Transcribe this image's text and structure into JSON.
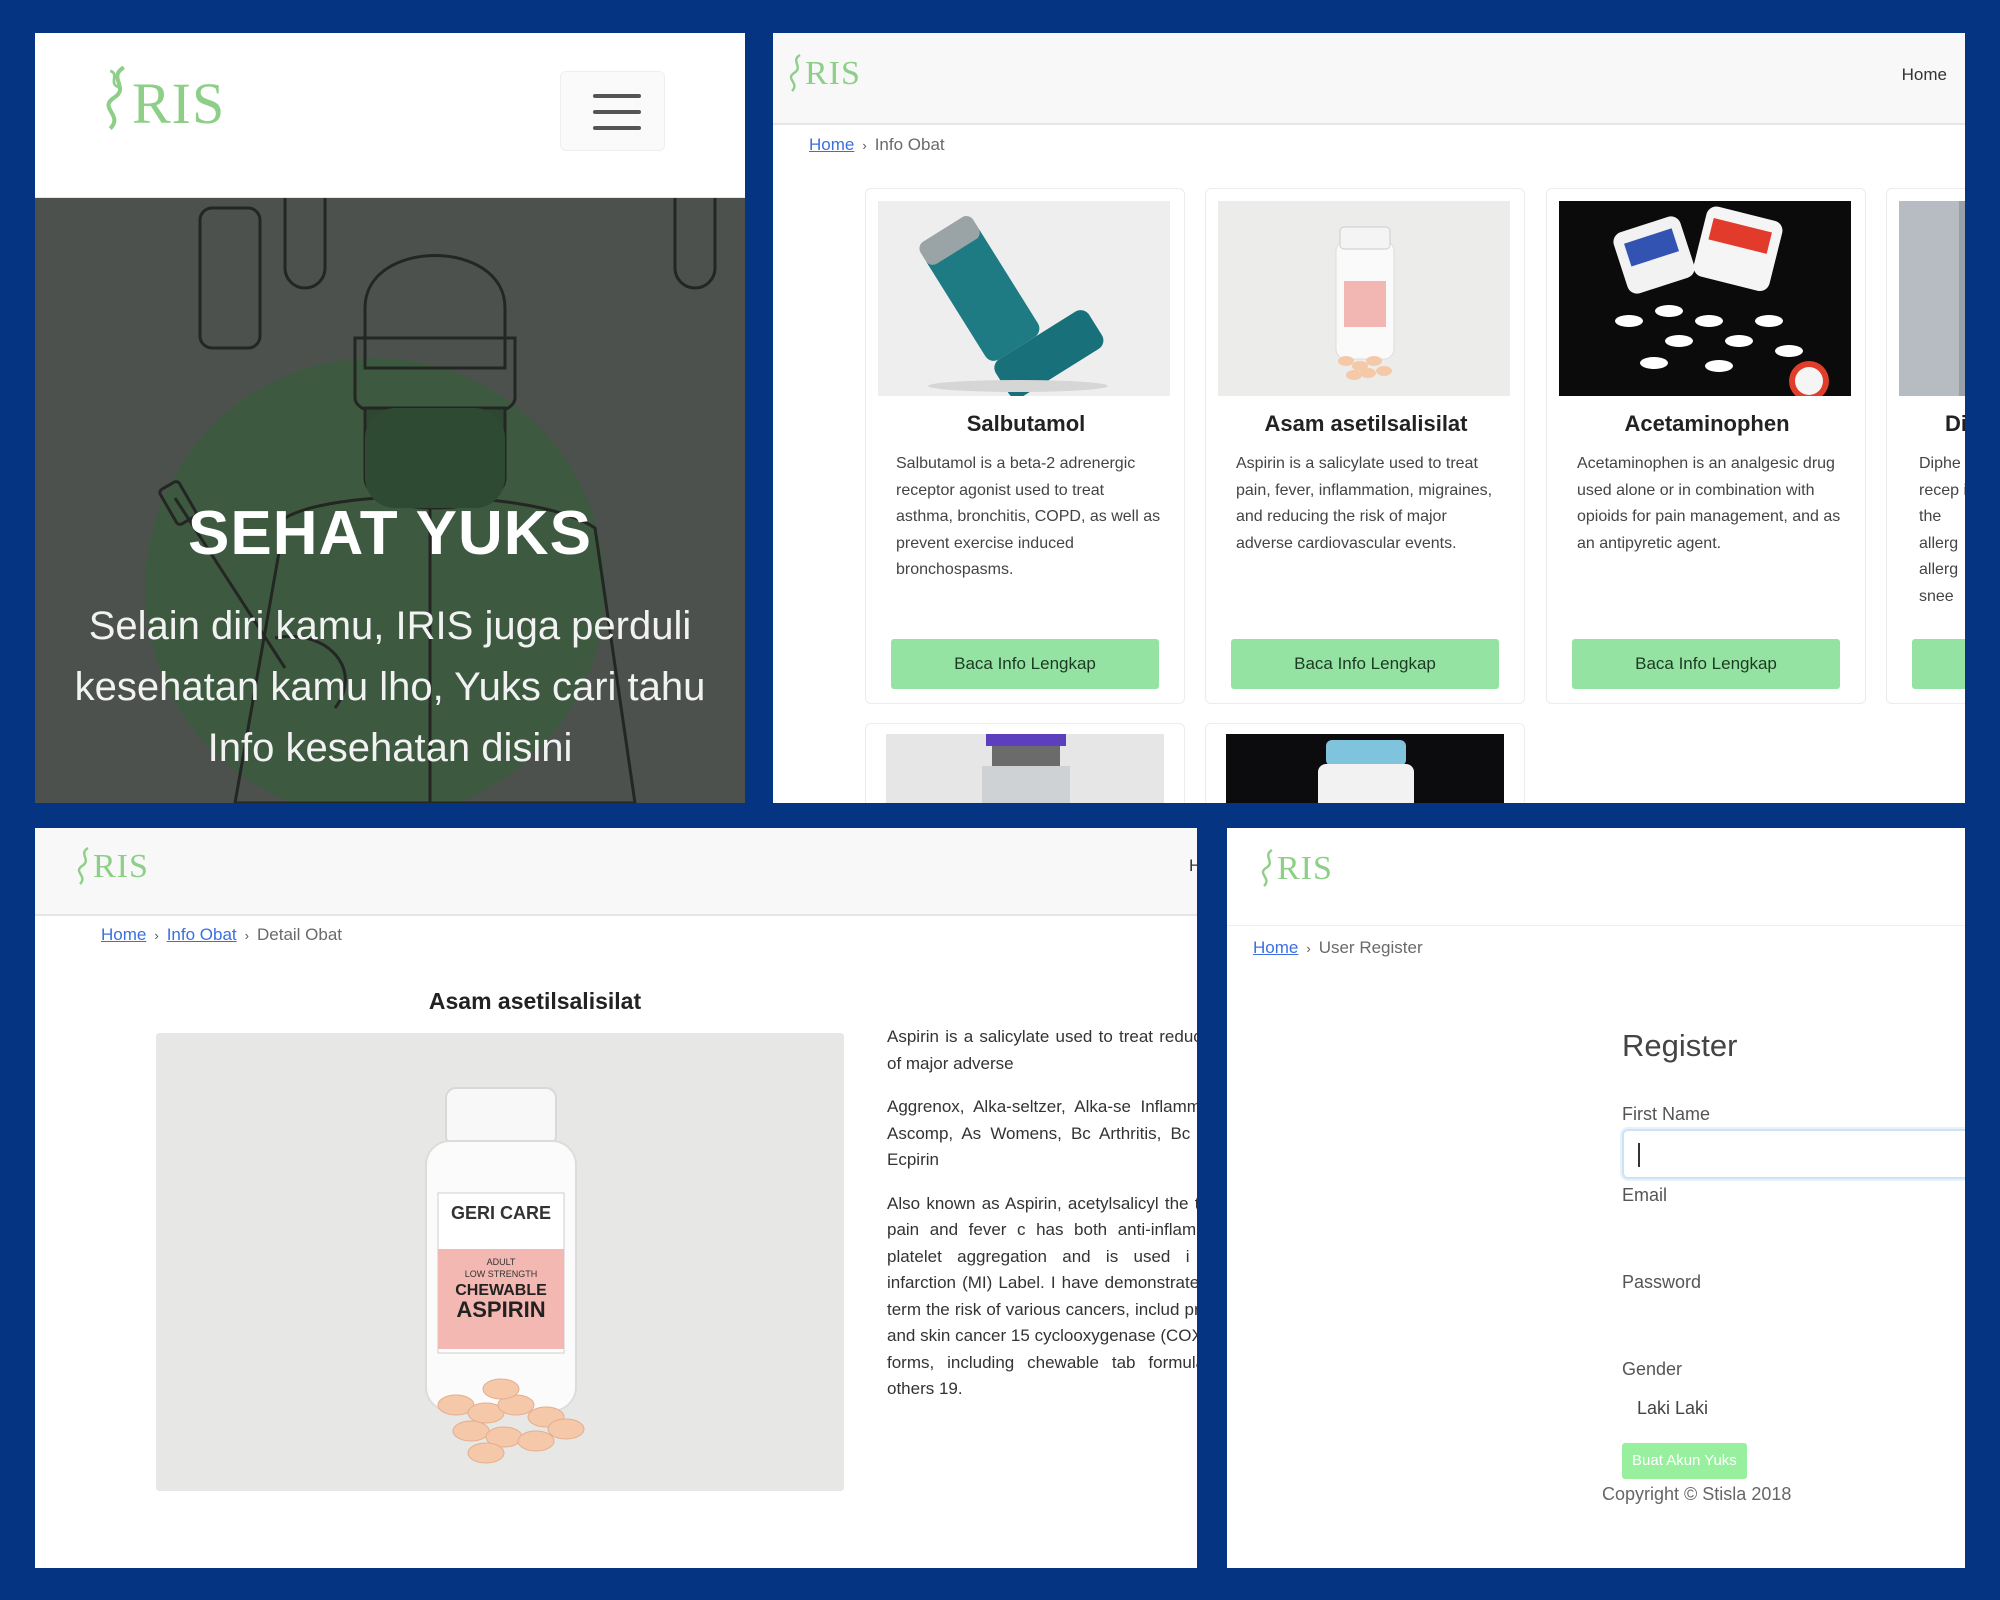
{
  "brand": {
    "logo_text": "RIS"
  },
  "mobile_home": {
    "hero_title": "SEHAT YUKS",
    "hero_subtitle_lines": [
      "Selain diri kamu, IRIS juga perduli",
      "kesehatan kamu lho, Yuks cari tahu",
      "Info kesehatan disini"
    ]
  },
  "info_obat": {
    "nav_home": "Home",
    "breadcrumb": {
      "home": "Home",
      "current": "Info Obat"
    },
    "cards": [
      {
        "name": "Salbutamol",
        "desc": "Salbutamol is a beta-2 adrenergic receptor agonist used to treat asthma, bronchitis, COPD, as well as prevent exercise induced bronchospasms.",
        "button": "Baca Info Lengkap"
      },
      {
        "name": "Asam asetilsalisilat",
        "desc": "Aspirin is a salicylate used to treat pain, fever, inflammation, migraines, and reducing the risk of major adverse cardiovascular events.",
        "button": "Baca Info Lengkap"
      },
      {
        "name": "Acetaminophen",
        "desc": "Acetaminophen is an analgesic drug used alone or in combination with opioids for pain management, and as an antipyretic agent.",
        "button": "Baca Info Lengkap"
      },
      {
        "name": "Di",
        "desc": "Diphe recep in the allerg allerg snee",
        "button": ""
      }
    ]
  },
  "detail_obat": {
    "nav_home_cut": "H",
    "breadcrumb": {
      "home": "Home",
      "info": "Info Obat",
      "current": "Detail Obat"
    },
    "title": "Asam asetilsalisilat",
    "paragraphs": [
      "Aspirin is a salicylate used to treat reducing the risk of major adverse",
      "Aggrenox, Alka-seltzer, Alka-se Inflammatory Pain, Ascomp, As Womens, Bc Arthritis, Bc Original Fo Ecpirin",
      "Also known as Aspirin, acetylsalicyl the treatment of pain and fever c has both anti-inflammatory and platelet aggregation and is used i myocardial infarction (MI) Label. I have demonstrated that long-term the risk of various cancers, includ prostate, liver and skin cancer 15 cyclooxygenase (COX) inhibitor 1 forms, including chewable tab formulations, and others 19."
    ],
    "bottle_label": {
      "brand": "GERI CARE",
      "line1": "ADULT",
      "line2": "LOW STRENGTH",
      "line3": "CHEWABLE",
      "line4": "ASPIRIN"
    }
  },
  "register": {
    "breadcrumb": {
      "home": "Home",
      "current": "User Register"
    },
    "title": "Register",
    "first_name_label": "First Name",
    "first_name_value": "",
    "email_label": "Email",
    "password_label": "Password",
    "gender_label": "Gender",
    "gender_value": "Laki Laki",
    "submit": "Buat Akun Yuks",
    "copyright": "Copyright © Stisla 2018"
  },
  "colors": {
    "frame": "#053582",
    "brand_green": "#8ecf88",
    "button_green": "#95e3a2",
    "link_blue": "#3b6fe0"
  },
  "icons": [
    "dna-leaf-icon",
    "hamburger-menu-icon",
    "breadcrumb-chevron-icon"
  ]
}
